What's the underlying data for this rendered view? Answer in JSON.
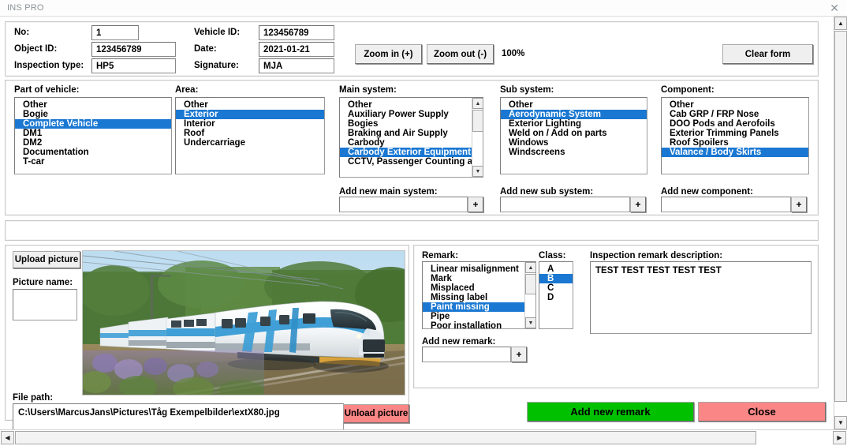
{
  "window": {
    "title": "INS PRO",
    "close_icon": "close-icon",
    "close_glyph": "✕"
  },
  "header": {
    "fields": [
      {
        "label": "No:",
        "value": "1"
      },
      {
        "label": "Object ID:",
        "value": "123456789"
      },
      {
        "label": "Inspection type:",
        "value": "HP5"
      },
      {
        "label": "Vehicle ID:",
        "value": "123456789"
      },
      {
        "label": "Date:",
        "value": "2021-01-21"
      },
      {
        "label": "Signature:",
        "value": "MJA"
      }
    ],
    "zoom_in_label": "Zoom in (+)",
    "zoom_out_label": "Zoom out (-)",
    "zoom_level": "100%",
    "clear_form_label": "Clear form"
  },
  "selection": {
    "part_of_vehicle": {
      "label": "Part of vehicle:",
      "options": [
        "Other",
        "Bogie",
        "Complete Vehicle",
        "DM1",
        "DM2",
        "Documentation",
        "T-car"
      ],
      "selected": "Complete Vehicle"
    },
    "area": {
      "label": "Area:",
      "options": [
        "Other",
        "Exterior",
        "Interior",
        "Roof",
        "Undercarriage"
      ],
      "selected": "Exterior"
    },
    "main_system": {
      "label": "Main system:",
      "options": [
        "Other",
        "Auxiliary Power Supply",
        "Bogies",
        "Braking and Air Supply",
        "Carbody",
        "Carbody Exterior Equipment",
        "CCTV, Passenger Counting and Ti"
      ],
      "selected": "Carbody Exterior Equipment",
      "add_label": "Add new main system:",
      "add_value": "",
      "add_button": "+"
    },
    "sub_system": {
      "label": "Sub system:",
      "options": [
        "Other",
        "Aerodynamic System",
        "Exterior Lighting",
        "Weld on / Add on parts",
        "Windows",
        "Windscreens"
      ],
      "selected": "Aerodynamic System",
      "add_label": "Add new sub system:",
      "add_value": "",
      "add_button": "+"
    },
    "component": {
      "label": "Component:",
      "options": [
        "Other",
        "Cab GRP / FRP Nose",
        "DOO Pods and Aerofoils",
        "Exterior Trimming Panels",
        "Roof Spoilers",
        "Valance / Body Skirts"
      ],
      "selected": "Valance / Body Skirts",
      "add_label": "Add new component:",
      "add_value": "",
      "add_button": "+"
    }
  },
  "picture": {
    "upload_label": "Upload picture",
    "name_label": "Picture name:",
    "name_value": "",
    "filepath_label": "File path:",
    "filepath_value": "C:\\Users\\MarcusJans\\Pictures\\Tåg Exempelbilder\\extX80.jpg",
    "unload_label": "Unload picture",
    "image_alt": "train-photo"
  },
  "remark": {
    "label": "Remark:",
    "options": [
      "Linear misalignment",
      "Mark",
      "Misplaced",
      "Missing label",
      "Paint missing",
      "Pipe",
      "Poor installation"
    ],
    "selected": "Paint missing",
    "add_label": "Add new remark:",
    "add_value": "",
    "add_button": "+",
    "class_label": "Class:",
    "class_options": [
      "A",
      "B",
      "C",
      "D"
    ],
    "class_selected": "B",
    "description_label": "Inspection remark description:",
    "description_value": "TEST TEST TEST TEST TEST"
  },
  "actions": {
    "add_remark_label": "Add new remark",
    "close_label": "Close"
  },
  "colors": {
    "selection_blue": "#1a78d2",
    "add_remark_green": "#00c000",
    "close_red": "#fa8686",
    "unload_red": "#fa8686"
  },
  "scroll": {
    "up_glyph": "▲",
    "down_glyph": "▼",
    "left_glyph": "◀",
    "right_glyph": "▶"
  }
}
